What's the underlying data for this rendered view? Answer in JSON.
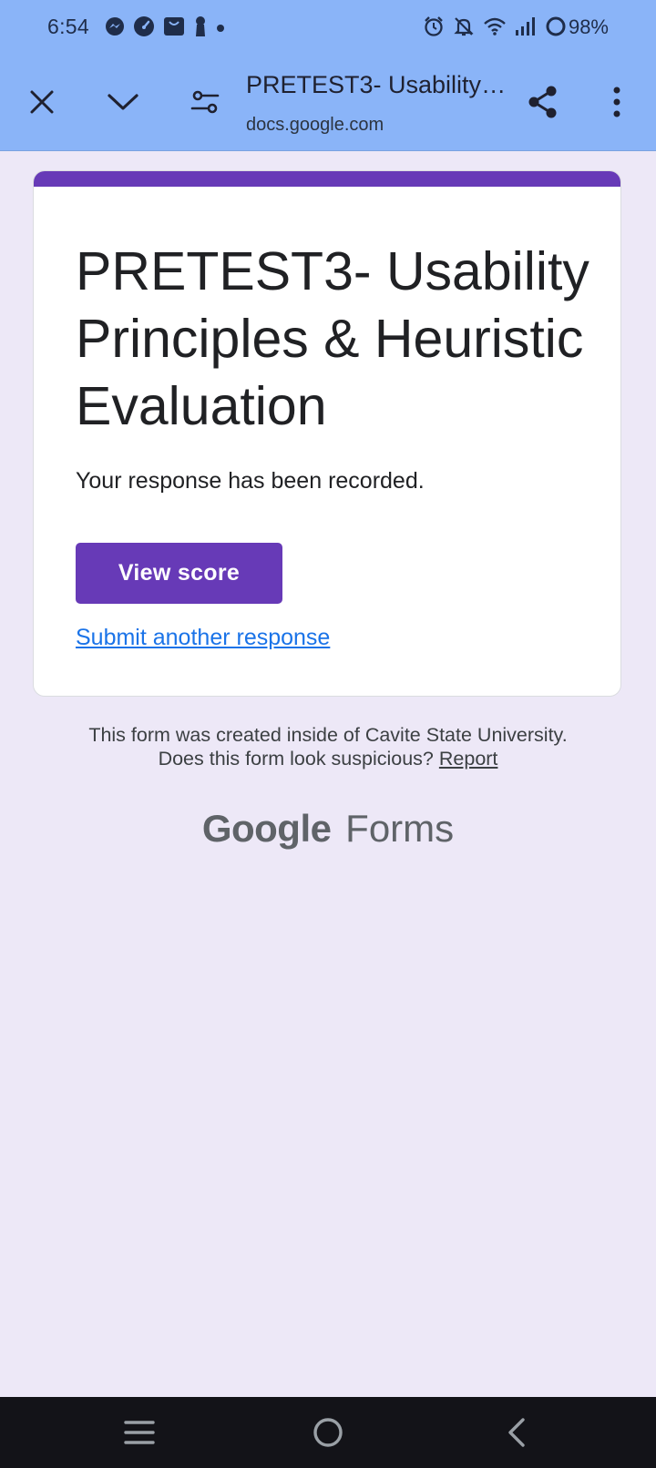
{
  "status_bar": {
    "time": "6:54",
    "battery": "98%",
    "left_icons": [
      "messenger-icon",
      "speedometer-icon",
      "shopping-bag-icon",
      "keyhole-icon",
      "dot-icon"
    ],
    "right_icons": [
      "alarm-icon",
      "bell-off-icon",
      "wifi-icon",
      "signal-icon",
      "sync-icon"
    ]
  },
  "app_bar": {
    "title": "PRETEST3- Usability ...",
    "url": "docs.google.com",
    "icons": [
      "close-icon",
      "chevron-down-icon",
      "tune-icon",
      "share-icon",
      "more-vert-icon"
    ]
  },
  "form": {
    "title": "PRETEST3- Usability Principles & Heuristic Evaluation",
    "confirmation": "Your response has been recorded.",
    "view_score_label": "View score",
    "submit_another_label": "Submit another response",
    "accent_color": "#673ab7"
  },
  "footer": {
    "line1": "This form was created inside of Cavite State University.",
    "line2_prefix": "Does this form look suspicious?",
    "report_label": "Report",
    "brand_google": "Google",
    "brand_forms": "Forms"
  },
  "nav_bar": {
    "icons": [
      "recents-icon",
      "home-icon",
      "back-icon"
    ]
  },
  "colors": {
    "app_bar_bg": "#8ab4f8",
    "page_bg": "#ede8f7",
    "link": "#1a73e8",
    "nav_bar_bg": "#131318"
  }
}
